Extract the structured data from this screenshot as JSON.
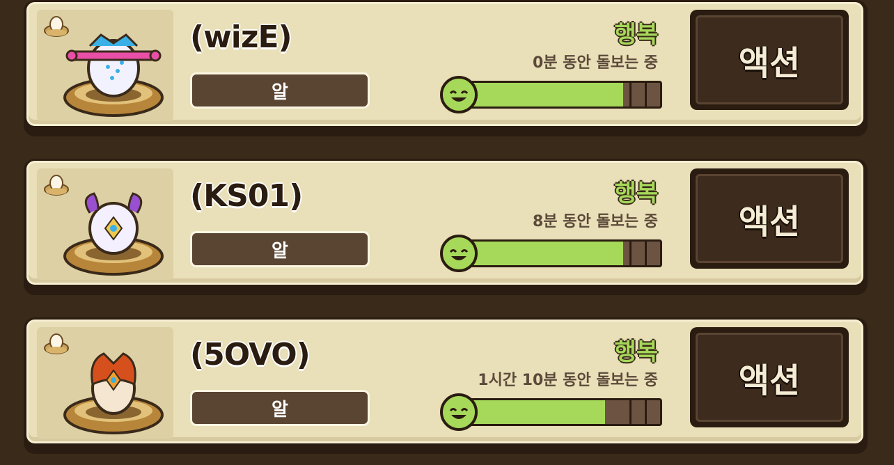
{
  "pets": [
    {
      "name": "(wizE)",
      "type": "알",
      "status": "행복",
      "care_time": "0분 동안 돌보는 중",
      "happiness": 0.82,
      "action_label": "액션",
      "pet_colors": [
        "#e94fa6",
        "#3ab0e6",
        "#f2f2ff"
      ]
    },
    {
      "name": "(KS01)",
      "type": "알",
      "status": "행복",
      "care_time": "8분 동안 돌보는 중",
      "happiness": 0.82,
      "action_label": "액션",
      "pet_colors": [
        "#9a4fd0",
        "#d6c0f0",
        "#f4f0ff"
      ]
    },
    {
      "name": "(5OVO)",
      "type": "알",
      "status": "행복",
      "care_time": "1시간 10분 동안 돌보는 중",
      "happiness": 0.73,
      "action_label": "액션",
      "pet_colors": [
        "#d6501e",
        "#f0a030",
        "#f4e6d0"
      ]
    }
  ],
  "colors": {
    "status_green": "#a6d95a",
    "bar_empty": "#6d5442",
    "panel": "#e9dfb8",
    "dark": "#2a1c10"
  },
  "icons": {
    "badge": "egg-nest-icon",
    "face": "smiley-face-icon"
  }
}
